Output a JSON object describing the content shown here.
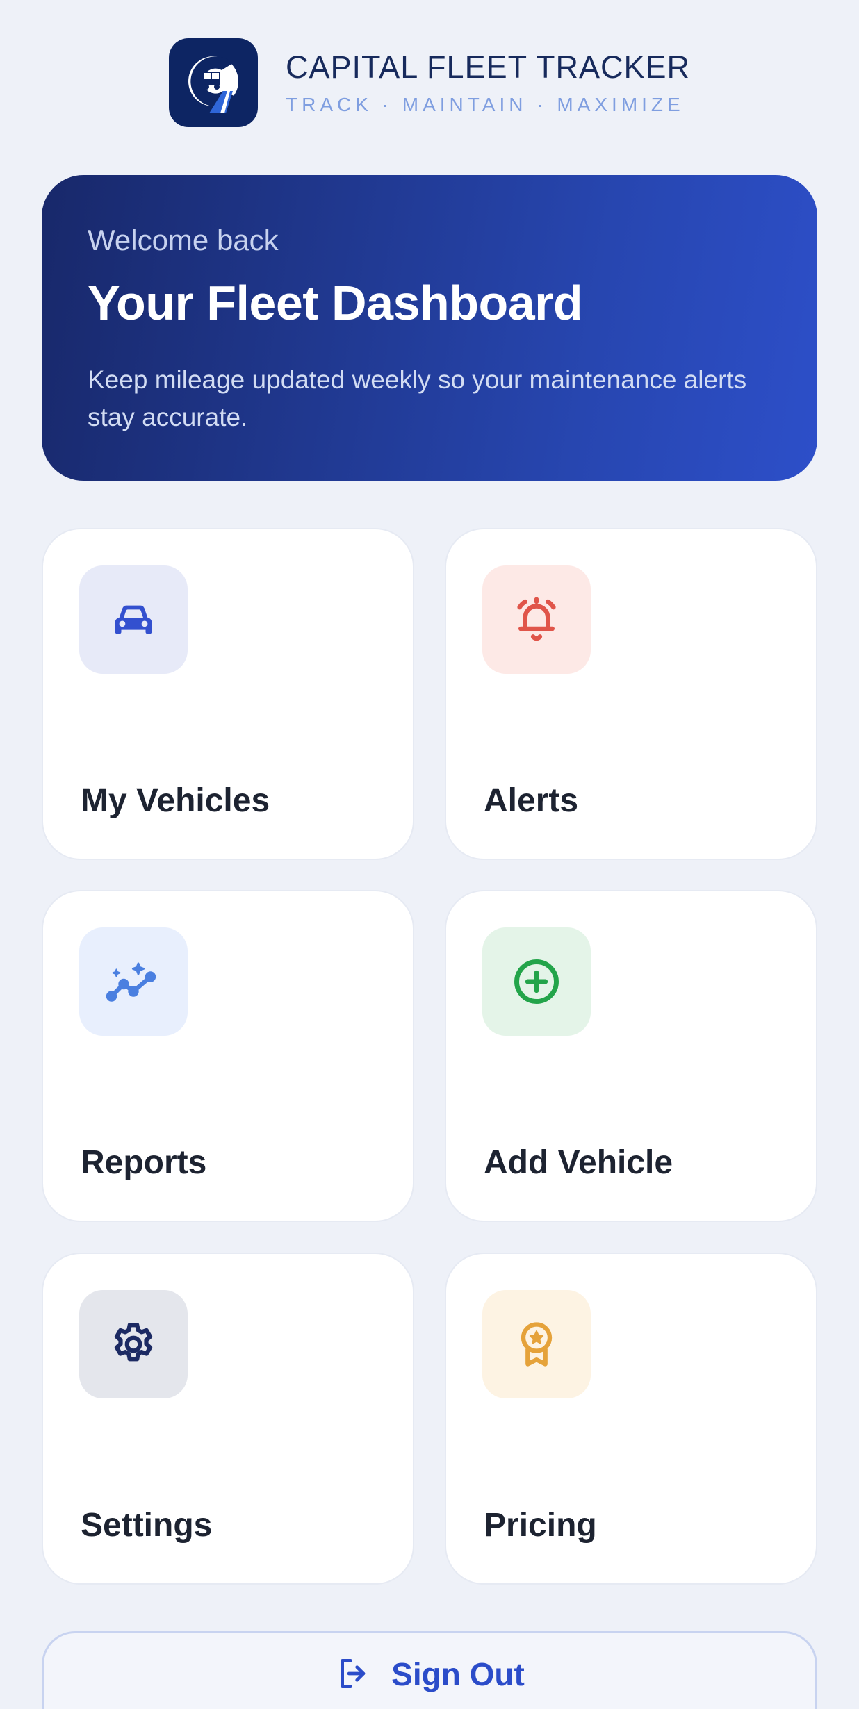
{
  "brand": {
    "title": "CAPITAL FLEET TRACKER",
    "tagline": "TRACK · MAINTAIN · MAXIMIZE",
    "logo_icon": "truck-road-logo-icon"
  },
  "hero": {
    "welcome": "Welcome back",
    "title": "Your Fleet Dashboard",
    "note": "Keep mileage updated weekly so your maintenance alerts stay accurate."
  },
  "tiles": [
    {
      "label": "My Vehicles",
      "icon": "car-icon",
      "icon_color": "#3350cf",
      "bg": "#e7eaf8"
    },
    {
      "label": "Alerts",
      "icon": "alarm-bell-icon",
      "icon_color": "#e0554a",
      "bg": "#fde9e6"
    },
    {
      "label": "Reports",
      "icon": "sparkle-trend-icon",
      "icon_color": "#4a7fe0",
      "bg": "#e8effd"
    },
    {
      "label": "Add Vehicle",
      "icon": "plus-circle-icon",
      "icon_color": "#23a44a",
      "bg": "#e4f4e8"
    },
    {
      "label": "Settings",
      "icon": "gear-icon",
      "icon_color": "#1c2a63",
      "bg": "#e4e6ec"
    },
    {
      "label": "Pricing",
      "icon": "award-badge-icon",
      "icon_color": "#e5a23a",
      "bg": "#fdf3e3"
    }
  ],
  "signout": {
    "label": "Sign Out",
    "icon": "logout-icon"
  },
  "colors": {
    "background": "#eef1f8",
    "accent": "#2b4cc9",
    "hero_dark": "#18286a"
  }
}
